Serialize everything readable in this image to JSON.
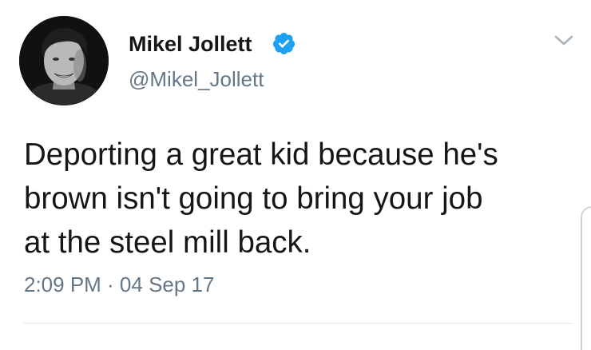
{
  "user": {
    "display_name": "Mikel Jollett",
    "handle": "@Mikel_Jollett",
    "verified": true,
    "avatar_icon": "profile-photo-bw"
  },
  "tweet": {
    "text_lines": [
      "Deporting a great kid because he's",
      "brown isn't going to bring your job",
      "at the steel mill back."
    ],
    "timestamp": "2:09 PM · 04 Sep 17"
  },
  "icons": {
    "verified": "verified-badge-icon",
    "menu": "chevron-down-icon"
  },
  "colors": {
    "text": "#14171a",
    "secondary": "#657786",
    "verified_blue": "#1da1f2",
    "divider": "#e1e8ed"
  }
}
